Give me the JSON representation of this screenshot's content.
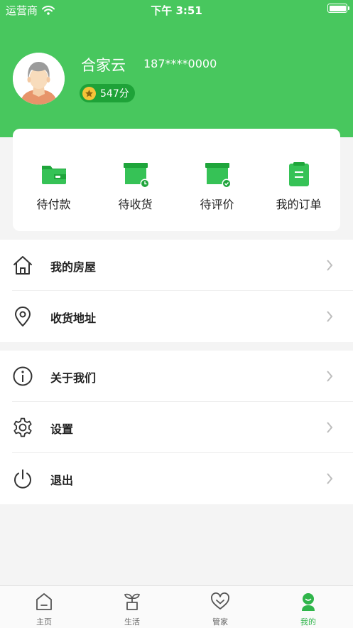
{
  "status_bar": {
    "carrier": "运营商",
    "time": "下午 3:51"
  },
  "profile": {
    "name": "合家云",
    "phone": "187****0000",
    "points": "547分"
  },
  "orders": [
    {
      "label": "待付款",
      "icon": "wallet-icon"
    },
    {
      "label": "待收货",
      "icon": "package-clock-icon"
    },
    {
      "label": "待评价",
      "icon": "package-check-icon"
    },
    {
      "label": "我的订单",
      "icon": "clipboard-icon"
    }
  ],
  "menu": {
    "group1": [
      {
        "label": "我的房屋",
        "icon": "house-icon"
      },
      {
        "label": "收货地址",
        "icon": "location-pin-icon"
      }
    ],
    "group2": [
      {
        "label": "关于我们",
        "icon": "info-icon"
      },
      {
        "label": "设置",
        "icon": "gear-icon"
      },
      {
        "label": "退出",
        "icon": "power-icon"
      }
    ]
  },
  "tabbar": [
    {
      "label": "主页",
      "icon": "home-icon"
    },
    {
      "label": "生活",
      "icon": "plant-pot-icon"
    },
    {
      "label": "管家",
      "icon": "heart-icon"
    },
    {
      "label": "我的",
      "icon": "person-icon",
      "active": true
    }
  ],
  "colors": {
    "brand_green": "#48c75e",
    "active_tab": "#2fb54a",
    "badge_green": "#1ea238",
    "star_gold": "#f6c338"
  }
}
